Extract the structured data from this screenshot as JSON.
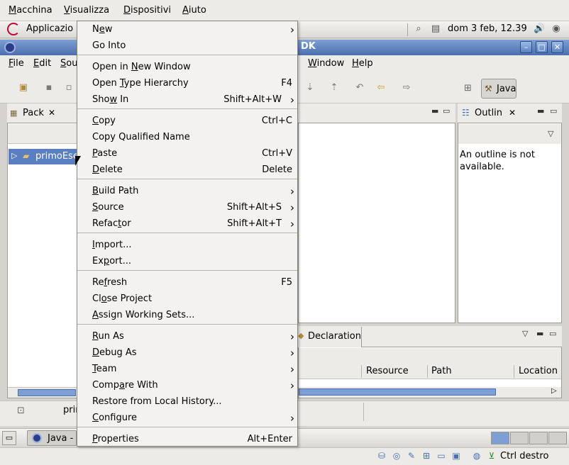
{
  "vbox_menubar": {
    "items": [
      "Macchina",
      "Visualizza",
      "Dispositivi",
      "Aiuto"
    ]
  },
  "gnome_panel": {
    "applications_label": "Applicazio",
    "clock": "dom  3 feb, 12.39"
  },
  "eclipse_window": {
    "title_fragment": "DK"
  },
  "eclipse_menubar": {
    "items": [
      "File",
      "Edit",
      "Sou",
      "Window",
      "Help"
    ]
  },
  "toolbar": {
    "perspective_label": "Java"
  },
  "package_explorer": {
    "tab_label": "Pack",
    "tree_item": "primoEse"
  },
  "outline": {
    "tab_label": "Outlin",
    "message": "An outline is not available."
  },
  "bottom_view": {
    "declaration_tab": "Declaration",
    "columns": [
      "Resource",
      "Path",
      "Location"
    ]
  },
  "status": {
    "text": "prin"
  },
  "taskbar": {
    "button_label": "Java -"
  },
  "vbox_status": {
    "host_key_label": "Ctrl destro"
  },
  "context_menu": {
    "items": [
      {
        "label": "New",
        "mnemonic": 1,
        "accel": "",
        "submenu": true
      },
      {
        "label": "Go Into",
        "mnemonic": -1,
        "accel": "",
        "submenu": false
      },
      {
        "label": "Open in New Window",
        "mnemonic": 8,
        "accel": "",
        "submenu": false
      },
      {
        "label": "Open Type Hierarchy",
        "mnemonic": 5,
        "accel": "F4",
        "submenu": false
      },
      {
        "label": "Show In",
        "mnemonic": 3,
        "accel": "Shift+Alt+W",
        "submenu": true
      },
      {
        "label": "Copy",
        "mnemonic": 0,
        "accel": "Ctrl+C",
        "submenu": false
      },
      {
        "label": "Copy Qualified Name",
        "mnemonic": -1,
        "accel": "",
        "submenu": false
      },
      {
        "label": "Paste",
        "mnemonic": 0,
        "accel": "Ctrl+V",
        "submenu": false
      },
      {
        "label": "Delete",
        "mnemonic": 0,
        "accel": "Delete",
        "submenu": false
      },
      {
        "label": "Build Path",
        "mnemonic": 0,
        "accel": "",
        "submenu": true
      },
      {
        "label": "Source",
        "mnemonic": 0,
        "accel": "Shift+Alt+S",
        "submenu": true
      },
      {
        "label": "Refactor",
        "mnemonic": 5,
        "accel": "Shift+Alt+T",
        "submenu": true
      },
      {
        "label": "Import...",
        "mnemonic": 0,
        "accel": "",
        "submenu": false
      },
      {
        "label": "Export...",
        "mnemonic": 2,
        "accel": "",
        "submenu": false
      },
      {
        "label": "Refresh",
        "mnemonic": 2,
        "accel": "F5",
        "submenu": false
      },
      {
        "label": "Close Project",
        "mnemonic": 2,
        "accel": "",
        "submenu": false
      },
      {
        "label": "Assign Working Sets...",
        "mnemonic": 0,
        "accel": "",
        "submenu": false
      },
      {
        "label": "Run As",
        "mnemonic": 0,
        "accel": "",
        "submenu": true
      },
      {
        "label": "Debug As",
        "mnemonic": 0,
        "accel": "",
        "submenu": true
      },
      {
        "label": "Team",
        "mnemonic": 0,
        "accel": "",
        "submenu": true
      },
      {
        "label": "Compare With",
        "mnemonic": 4,
        "accel": "",
        "submenu": true
      },
      {
        "label": "Restore from Local History...",
        "mnemonic": -1,
        "accel": "",
        "submenu": false
      },
      {
        "label": "Configure",
        "mnemonic": 0,
        "accel": "",
        "submenu": true
      },
      {
        "label": "Properties",
        "mnemonic": 0,
        "accel": "Alt+Enter",
        "submenu": false
      }
    ]
  }
}
